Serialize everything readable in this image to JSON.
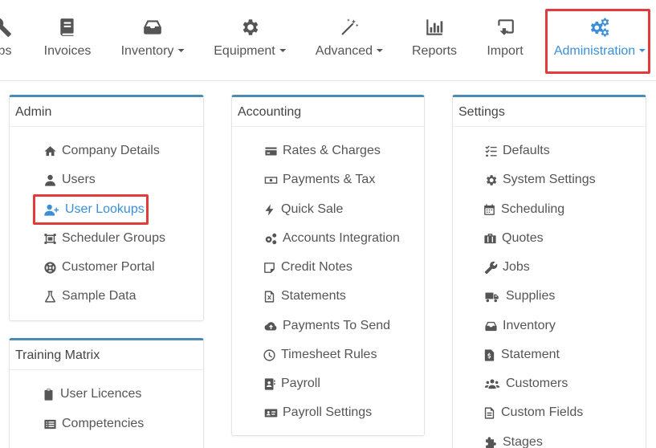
{
  "nav": {
    "items": [
      {
        "label": "bs",
        "icon": "wrench-icon",
        "dropdown": false
      },
      {
        "label": "Invoices",
        "icon": "book-icon",
        "dropdown": false
      },
      {
        "label": "Inventory",
        "icon": "inbox-tray-icon",
        "dropdown": true
      },
      {
        "label": "Equipment",
        "icon": "gear-icon",
        "dropdown": true
      },
      {
        "label": "Advanced",
        "icon": "magic-wand-icon",
        "dropdown": true
      },
      {
        "label": "Reports",
        "icon": "bar-chart-icon",
        "dropdown": false
      },
      {
        "label": "Import",
        "icon": "import-icon",
        "dropdown": false
      },
      {
        "label": "Administration",
        "icon": "gears-icon",
        "dropdown": true,
        "active": true
      }
    ]
  },
  "panels": {
    "admin": {
      "title": "Admin",
      "items": [
        {
          "label": "Company Details",
          "icon": "home-icon"
        },
        {
          "label": "Users",
          "icon": "user-icon"
        },
        {
          "label": "User Lookups",
          "icon": "user-plus-icon",
          "selected": true
        },
        {
          "label": "Scheduler Groups",
          "icon": "object-group-icon"
        },
        {
          "label": "Customer Portal",
          "icon": "life-ring-icon"
        },
        {
          "label": "Sample Data",
          "icon": "flask-icon"
        }
      ]
    },
    "training": {
      "title": "Training Matrix",
      "items": [
        {
          "label": "User Licences",
          "icon": "clipboard-icon"
        },
        {
          "label": "Competencies",
          "icon": "list-alt-icon"
        }
      ]
    },
    "accounting": {
      "title": "Accounting",
      "items": [
        {
          "label": "Rates & Charges",
          "icon": "credit-card-icon"
        },
        {
          "label": "Payments & Tax",
          "icon": "money-bill-icon"
        },
        {
          "label": "Quick Sale",
          "icon": "bolt-icon"
        },
        {
          "label": "Accounts Integration",
          "icon": "gears-icon"
        },
        {
          "label": "Credit Notes",
          "icon": "sticky-note-icon"
        },
        {
          "label": "Statements",
          "icon": "file-excel-icon"
        },
        {
          "label": "Payments To Send",
          "icon": "cloud-upload-icon"
        },
        {
          "label": "Timesheet Rules",
          "icon": "clock-icon"
        },
        {
          "label": "Payroll",
          "icon": "address-book-icon"
        },
        {
          "label": "Payroll Settings",
          "icon": "id-card-icon"
        }
      ]
    },
    "settings": {
      "title": "Settings",
      "items": [
        {
          "label": "Defaults",
          "icon": "tasks-icon"
        },
        {
          "label": "System Settings",
          "icon": "gear-icon"
        },
        {
          "label": "Scheduling",
          "icon": "calendar-icon"
        },
        {
          "label": "Quotes",
          "icon": "briefcase-icon"
        },
        {
          "label": "Jobs",
          "icon": "wrench-icon"
        },
        {
          "label": "Supplies",
          "icon": "truck-icon"
        },
        {
          "label": "Inventory",
          "icon": "inbox-tray-icon"
        },
        {
          "label": "Statement",
          "icon": "file-invoice-dollar-icon"
        },
        {
          "label": "Customers",
          "icon": "users-icon"
        },
        {
          "label": "Custom Fields",
          "icon": "file-alt-icon"
        },
        {
          "label": "Stages",
          "icon": "puzzle-icon"
        }
      ]
    }
  },
  "colors": {
    "accent": "#3a8fd8",
    "highlight": "#e23b3b",
    "panel_top": "#4b8bb5",
    "text": "#555555"
  }
}
